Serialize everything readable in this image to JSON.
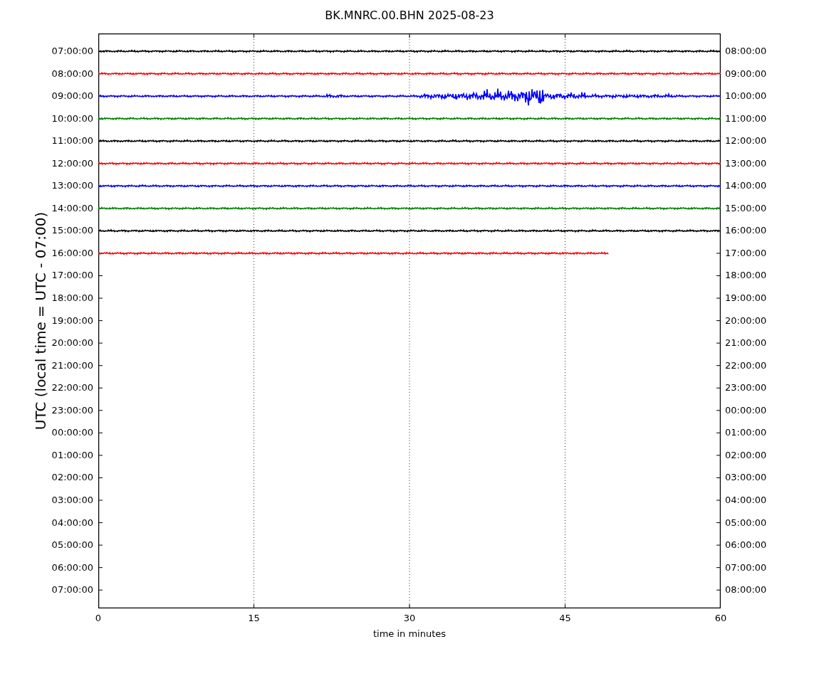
{
  "title": "BK.MNRC.00.BHN 2025-08-23",
  "ylabel": "UTC (local time = UTC - 07:00)",
  "xlabel": "time in minutes",
  "xticks": [
    "0",
    "15",
    "30",
    "45",
    "60"
  ],
  "left_labels": [
    "07:00:00",
    "08:00:00",
    "09:00:00",
    "10:00:00",
    "11:00:00",
    "12:00:00",
    "13:00:00",
    "14:00:00",
    "15:00:00",
    "16:00:00",
    "17:00:00",
    "18:00:00",
    "19:00:00",
    "20:00:00",
    "21:00:00",
    "22:00:00",
    "23:00:00",
    "00:00:00",
    "01:00:00",
    "02:00:00",
    "03:00:00",
    "04:00:00",
    "05:00:00",
    "06:00:00",
    "07:00:00"
  ],
  "right_labels": [
    "08:00:00",
    "09:00:00",
    "10:00:00",
    "11:00:00",
    "12:00:00",
    "13:00:00",
    "14:00:00",
    "15:00:00",
    "16:00:00",
    "17:00:00",
    "18:00:00",
    "19:00:00",
    "20:00:00",
    "21:00:00",
    "22:00:00",
    "23:00:00",
    "00:00:00",
    "01:00:00",
    "02:00:00",
    "03:00:00",
    "04:00:00",
    "05:00:00",
    "06:00:00",
    "07:00:00",
    "08:00:00"
  ],
  "traces": [
    {
      "color": "#000000",
      "kind": "full"
    },
    {
      "color": "#ff0000",
      "kind": "full"
    },
    {
      "color": "#0000ff",
      "kind": "event"
    },
    {
      "color": "#008000",
      "kind": "full"
    },
    {
      "color": "#000000",
      "kind": "full"
    },
    {
      "color": "#ff0000",
      "kind": "full"
    },
    {
      "color": "#0000ff",
      "kind": "full"
    },
    {
      "color": "#008000",
      "kind": "full"
    },
    {
      "color": "#000000",
      "kind": "full"
    },
    {
      "color": "#ff0000",
      "kind": "partial"
    }
  ]
}
